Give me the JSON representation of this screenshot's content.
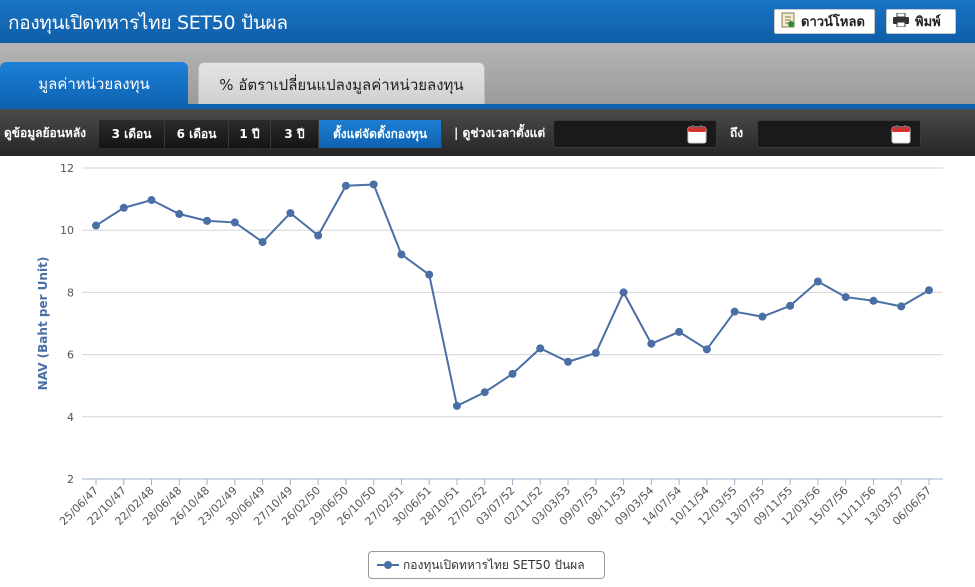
{
  "header": {
    "title": "กองทุนเปิดทหารไทย SET50 ปันผล",
    "download_label": "ดาวน์โหลด",
    "print_label": "พิมพ์"
  },
  "tabs": [
    {
      "label": "มูลค่าหน่วยลงทุน",
      "active": true
    },
    {
      "label": "% อัตราเปลี่ยนแปลงมูลค่าหน่วยลงทุน",
      "active": false
    }
  ],
  "toolbar": {
    "lookback_label": "ดูข้อมูลย้อนหลัง",
    "ranges": [
      "3 เดือน",
      "6 เดือน",
      "1 ปี",
      "3 ปี",
      "ตั้งแต่จัดตั้งกองทุน"
    ],
    "active_range": "ตั้งแต่จัดตั้งกองทุน",
    "period_label": "| ดูช่วงเวลาตั้งแต่",
    "to_label": "ถึง",
    "from_value": "",
    "to_value": ""
  },
  "colors": {
    "series": "#4a6fa5",
    "accent": "#0f62b0"
  },
  "chart_data": {
    "type": "line",
    "title": "",
    "xlabel": "",
    "ylabel": "NAV (Baht per Unit)",
    "ylim": [
      2,
      12
    ],
    "yticks": [
      2,
      4,
      6,
      8,
      10,
      12
    ],
    "grid": true,
    "legend": "bottom-center",
    "categories": [
      "25/06/47",
      "22/10/47",
      "22/02/48",
      "28/06/48",
      "26/10/48",
      "23/02/49",
      "30/06/49",
      "27/10/49",
      "26/02/50",
      "29/06/50",
      "26/10/50",
      "27/02/51",
      "30/06/51",
      "28/10/51",
      "27/02/52",
      "03/07/52",
      "02/11/52",
      "03/03/53",
      "09/07/53",
      "08/11/53",
      "09/03/54",
      "14/07/54",
      "10/11/54",
      "12/03/55",
      "13/07/55",
      "09/11/55",
      "12/03/56",
      "15/07/56",
      "11/11/56",
      "13/03/57",
      "06/06/57"
    ],
    "series": [
      {
        "name": "กองทุนเปิดทหารไทย SET50 ปันผล",
        "values": [
          10.15,
          10.72,
          10.97,
          10.52,
          10.3,
          10.25,
          9.62,
          10.55,
          9.83,
          11.43,
          11.47,
          9.22,
          8.57,
          4.35,
          4.79,
          5.38,
          6.2,
          5.77,
          6.05,
          8.0,
          6.35,
          6.73,
          6.17,
          7.38,
          7.22,
          7.57,
          8.35,
          7.85,
          7.73,
          7.55,
          8.07
        ]
      }
    ]
  }
}
